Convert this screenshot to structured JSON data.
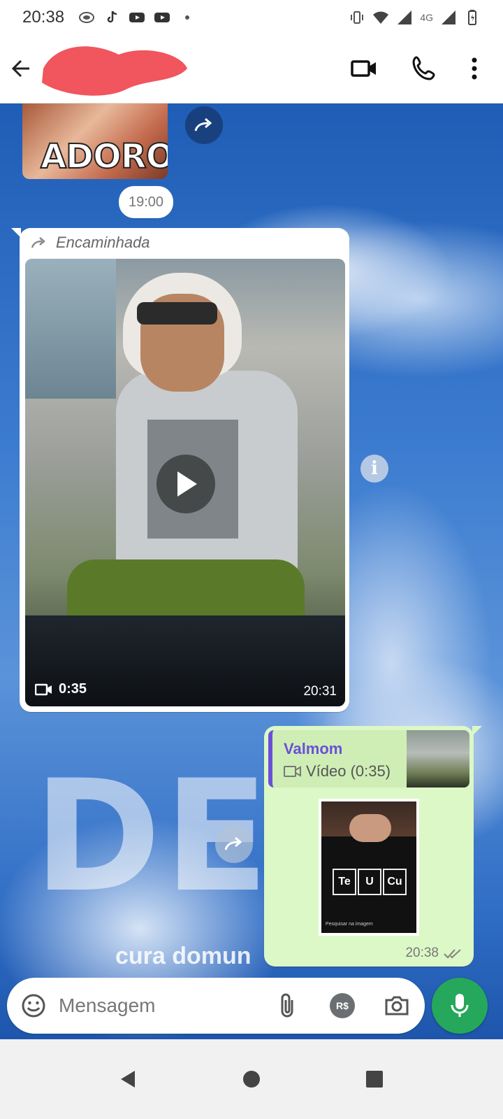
{
  "status_bar": {
    "time": "20:38",
    "network": "4G"
  },
  "header": {
    "contact_name": "",
    "back_icon": "arrow-left-icon",
    "video_call_icon": "video-camera-icon",
    "voice_call_icon": "phone-icon",
    "menu_icon": "more-vert-icon"
  },
  "chat": {
    "sticker_text": "ADORO!",
    "date_separator": "19:00",
    "wallpaper_text": "DEU",
    "wallpaper_subtext": "cura domun",
    "incoming_message": {
      "forwarded_label": "Encaminhada",
      "video_duration": "0:35",
      "time": "20:31"
    },
    "outgoing_message": {
      "quote_name": "Valmom",
      "quote_type": "Vídeo (0:35)",
      "image_caption": "Pesquisar na imagem",
      "shirt_elements": [
        "Te",
        "U",
        "Cu"
      ],
      "time": "20:38",
      "read_status": "double-check-icon"
    }
  },
  "input_bar": {
    "placeholder": "Mensagem",
    "pay_label": "R$"
  },
  "colors": {
    "accent_green": "#25a85b",
    "outgoing_bubble": "#dcf8c6",
    "quote_bar": "#6b4fd9"
  }
}
